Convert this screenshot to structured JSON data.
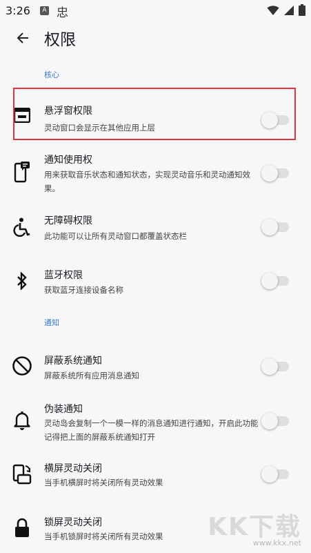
{
  "status_bar": {
    "time": "3:26",
    "a_badge": "A",
    "bug_glyph": "忠"
  },
  "app_bar": {
    "title": "权限"
  },
  "sections": {
    "core": "核心",
    "notify": "通知"
  },
  "rows": [
    {
      "title": "悬浮窗权限",
      "summary": "灵动窗口会显示在其他应用上层",
      "icon": "window-icon",
      "enabled": false
    },
    {
      "title": "通知使用权",
      "summary": "用来获取音乐状态和通知状态，实现灵动音乐和灵动通知效果。",
      "icon": "phone-message-icon",
      "enabled": false
    },
    {
      "title": "无障碍权限",
      "summary": "此功能可以让所有灵动窗口都覆盖状态栏",
      "icon": "accessibility-icon",
      "enabled": false
    },
    {
      "title": "蓝牙权限",
      "summary": "获取蓝牙连接设备名称",
      "icon": "bluetooth-icon",
      "enabled": false
    },
    {
      "title": "屏蔽系统通知",
      "summary": "屏蔽系统所有应用消息通知",
      "icon": "block-icon",
      "enabled": false
    },
    {
      "title": "伪装通知",
      "summary": "灵动岛会复制一个一模一样的消息通知进行通知，开启此功能记得把上面的屏蔽系统通知打开",
      "icon": "bell-icon",
      "enabled": false
    },
    {
      "title": "横屏灵动关闭",
      "summary": "当手机横屏时将关闭所有灵动效果",
      "icon": "screen-rotation-icon",
      "enabled": false
    },
    {
      "title": "锁屏灵动关闭",
      "summary": "当手机锁屏时将关闭所有灵动效果",
      "icon": "lock-icon",
      "enabled": false
    }
  ],
  "watermark": {
    "main": "KK下载",
    "url": "www.kkx.net"
  },
  "colors": {
    "accent": "#3a77c9",
    "highlight": "#e0343b",
    "background": "#f7f7f9"
  }
}
